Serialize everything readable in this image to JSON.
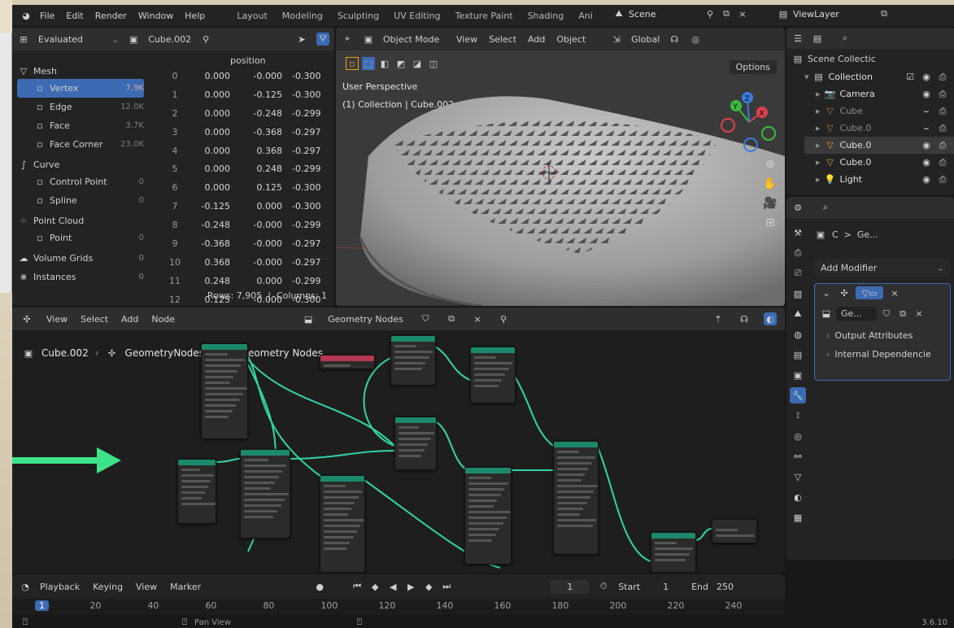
{
  "topbar": {
    "menus": [
      "File",
      "Edit",
      "Render",
      "Window",
      "Help"
    ],
    "workspaces": [
      "Layout",
      "Modeling",
      "Sculpting",
      "UV Editing",
      "Texture Paint",
      "Shading",
      "Ani"
    ],
    "scene": "Scene",
    "view_layer": "ViewLayer"
  },
  "spreadsheet": {
    "mode": "Evaluated",
    "object": "Cube.002",
    "column_header": "position",
    "groups": [
      {
        "name": "Mesh",
        "icon": "mesh-icon",
        "items": [
          {
            "label": "Vertex",
            "count": "7.9K",
            "active": true
          },
          {
            "label": "Edge",
            "count": "12.0K"
          },
          {
            "label": "Face",
            "count": "3.7K"
          },
          {
            "label": "Face Corner",
            "count": "23.0K"
          }
        ]
      },
      {
        "name": "Curve",
        "icon": "curve-icon",
        "items": [
          {
            "label": "Control Point",
            "count": "0"
          },
          {
            "label": "Spline",
            "count": "0"
          }
        ]
      },
      {
        "name": "Point Cloud",
        "icon": "point-cloud-icon",
        "items": [
          {
            "label": "Point",
            "count": "0"
          }
        ]
      },
      {
        "name": "Volume Grids",
        "icon": "volume-icon",
        "count": "0",
        "items": []
      },
      {
        "name": "Instances",
        "icon": "instances-icon",
        "count": "0",
        "items": []
      }
    ],
    "rows": [
      [
        "0",
        "0.000",
        "-0.000",
        "-0.300"
      ],
      [
        "1",
        "0.000",
        "-0.125",
        "-0.300"
      ],
      [
        "2",
        "0.000",
        "-0.248",
        "-0.299"
      ],
      [
        "3",
        "0.000",
        "-0.368",
        "-0.297"
      ],
      [
        "4",
        "0.000",
        "0.368",
        "-0.297"
      ],
      [
        "5",
        "0.000",
        "0.248",
        "-0.299"
      ],
      [
        "6",
        "0.000",
        "0.125",
        "-0.300"
      ],
      [
        "7",
        "-0.125",
        "0.000",
        "-0.300"
      ],
      [
        "8",
        "-0.248",
        "-0.000",
        "-0.299"
      ],
      [
        "9",
        "-0.368",
        "-0.000",
        "-0.297"
      ],
      [
        "10",
        "0.368",
        "-0.000",
        "-0.297"
      ],
      [
        "11",
        "0.248",
        "0.000",
        "-0.299"
      ],
      [
        "12",
        "0.125",
        "-0.000",
        "-0.300"
      ]
    ],
    "footer": "Rows: 7,905  |  Columns: 1"
  },
  "viewport": {
    "mode": "Object Mode",
    "menus": [
      "View",
      "Select",
      "Add",
      "Object"
    ],
    "orientation": "Global",
    "options": "Options",
    "perspective": "User Perspective",
    "collection": "(1) Collection | Cube.002"
  },
  "outliner": {
    "scene_collection": "Scene Collectic",
    "items": [
      {
        "label": "Collection",
        "icon": "collection-icon",
        "color": "#cfcfcf"
      },
      {
        "label": "Camera",
        "icon": "camera-icon",
        "color": "#e39b3a"
      },
      {
        "label": "Cube",
        "icon": "mesh-icon",
        "color": "#b57a45",
        "dim": true
      },
      {
        "label": "Cube.0",
        "icon": "mesh-icon",
        "color": "#b57a45",
        "dim": true
      },
      {
        "label": "Cube.0",
        "icon": "mesh-icon",
        "color": "#e39b3a",
        "active": true
      },
      {
        "label": "Cube.0",
        "icon": "mesh-icon",
        "color": "#e39b3a"
      },
      {
        "label": "Light",
        "icon": "light-icon",
        "color": "#e39b3a"
      }
    ]
  },
  "properties": {
    "breadcrumb": "C  >  Ge...",
    "add_modifier": "Add Modifier",
    "modifier_name": "Ge...",
    "output_attributes": "Output Attributes",
    "internal_dependencies": "Internal Dependencie"
  },
  "node_editor": {
    "menus": [
      "View",
      "Select",
      "Add",
      "Node"
    ],
    "tree_name": "Geometry Nodes",
    "breadcrumb": [
      "Cube.002",
      "GeometryNodes",
      "Geometry Nodes"
    ],
    "float_label": "Geometry Nodes"
  },
  "timeline": {
    "menus": [
      "Playback",
      "Keying",
      "View",
      "Marker"
    ],
    "current_frame": "1",
    "start_label": "Start",
    "start": "1",
    "end_label": "End",
    "end": "250",
    "ticks": [
      "1",
      "20",
      "40",
      "60",
      "80",
      "100",
      "120",
      "140",
      "160",
      "180",
      "200",
      "220",
      "240"
    ]
  },
  "statusbar": {
    "hint": "Pan View",
    "version": "3.6.10"
  },
  "colors": {
    "accent": "#3d6bb3",
    "node_wire": "#34d4a6",
    "arrow": "#3ee28a"
  }
}
